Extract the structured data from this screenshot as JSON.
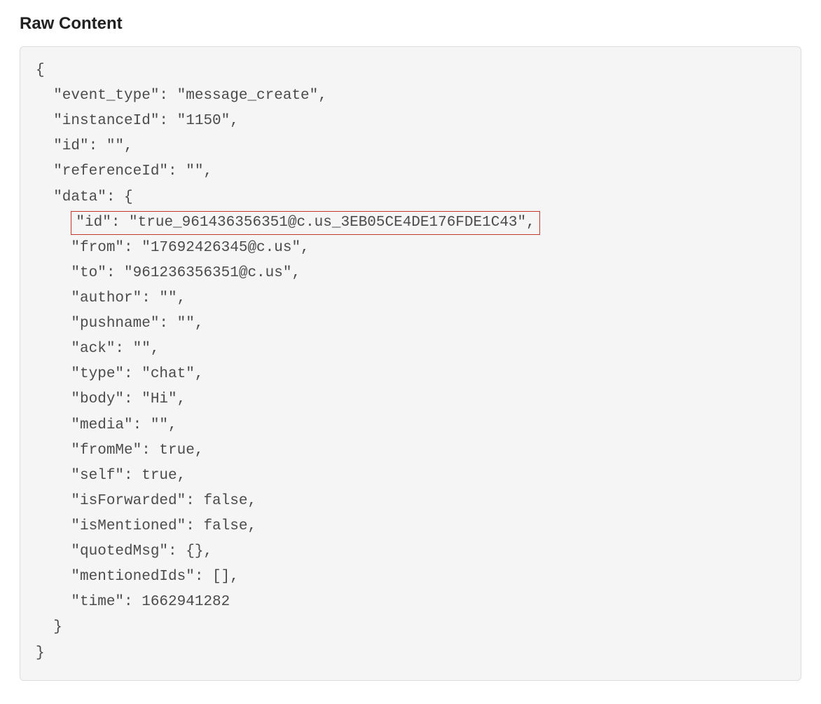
{
  "heading": "Raw Content",
  "code": {
    "open_brace": "{",
    "line_event_type": "  \"event_type\": \"message_create\",",
    "line_instanceId": "  \"instanceId\": \"1150\",",
    "line_id": "  \"id\": \"\",",
    "line_referenceId": "  \"referenceId\": \"\",",
    "line_data_open": "  \"data\": {",
    "indent_highlight_prefix": "    ",
    "line_data_id_highlighted": "\"id\": \"true_961436356351@c.us_3EB05CE4DE176FDE1C43\",",
    "line_from": "    \"from\": \"17692426345@c.us\",",
    "line_to": "    \"to\": \"961236356351@c.us\",",
    "line_author": "    \"author\": \"\",",
    "line_pushname": "    \"pushname\": \"\",",
    "line_ack": "    \"ack\": \"\",",
    "line_type": "    \"type\": \"chat\",",
    "line_body": "    \"body\": \"Hi\",",
    "line_media": "    \"media\": \"\",",
    "line_fromMe": "    \"fromMe\": true,",
    "line_self": "    \"self\": true,",
    "line_isForwarded": "    \"isForwarded\": false,",
    "line_isMentioned": "    \"isMentioned\": false,",
    "line_quotedMsg": "    \"quotedMsg\": {},",
    "line_mentionedIds": "    \"mentionedIds\": [],",
    "line_time": "    \"time\": 1662941282",
    "line_data_close": "  }",
    "close_brace": "}"
  }
}
